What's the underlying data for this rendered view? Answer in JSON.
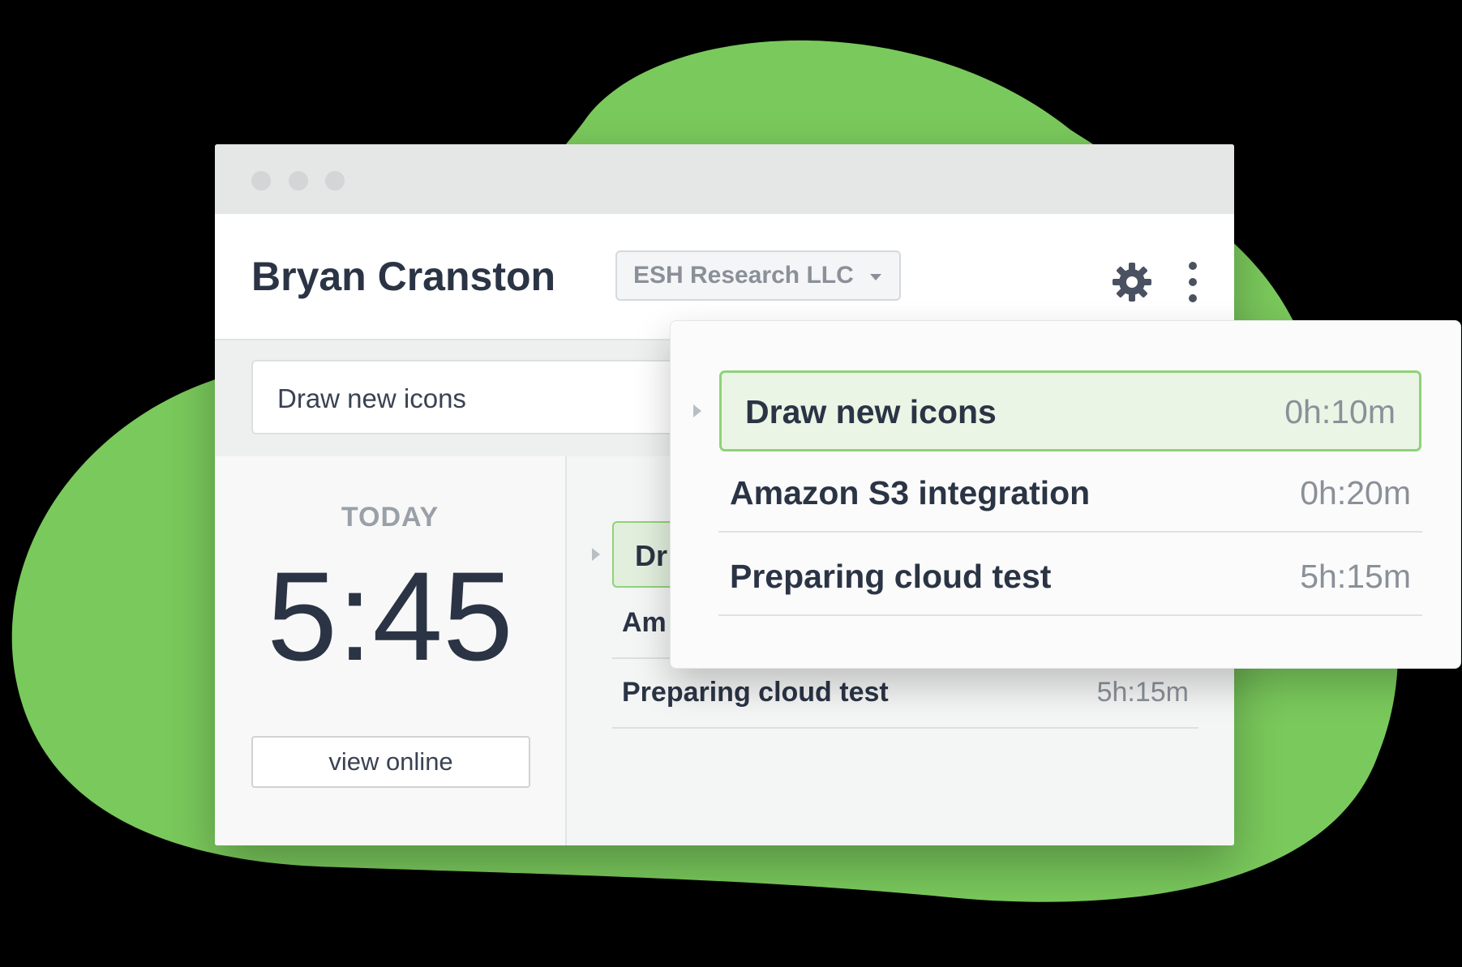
{
  "colors": {
    "brand_green": "#7ac95c",
    "accent_border": "#8fd279",
    "text_dark": "#2b3445",
    "text_muted": "#8a9099"
  },
  "header": {
    "user_name": "Bryan Cranston",
    "company": "ESH Research LLC",
    "settings_icon": "gear-icon",
    "more_icon": "kebab-menu-icon"
  },
  "task_input": {
    "value": "Draw new icons"
  },
  "today": {
    "label": "TODAY",
    "time": "5:45",
    "view_online_label": "view online"
  },
  "task_list": [
    {
      "name": "Draw new icons",
      "duration": "0h:10m",
      "active": true
    },
    {
      "name": "Amazon S3 integration",
      "duration": "0h:20m",
      "active": false
    },
    {
      "name": "Preparing cloud test",
      "duration": "5h:15m",
      "active": false
    }
  ],
  "background_list": {
    "active_partial": "Dr",
    "row2_partial": "Am",
    "row3_name": "Preparing cloud test",
    "row3_duration": "5h:15m"
  }
}
